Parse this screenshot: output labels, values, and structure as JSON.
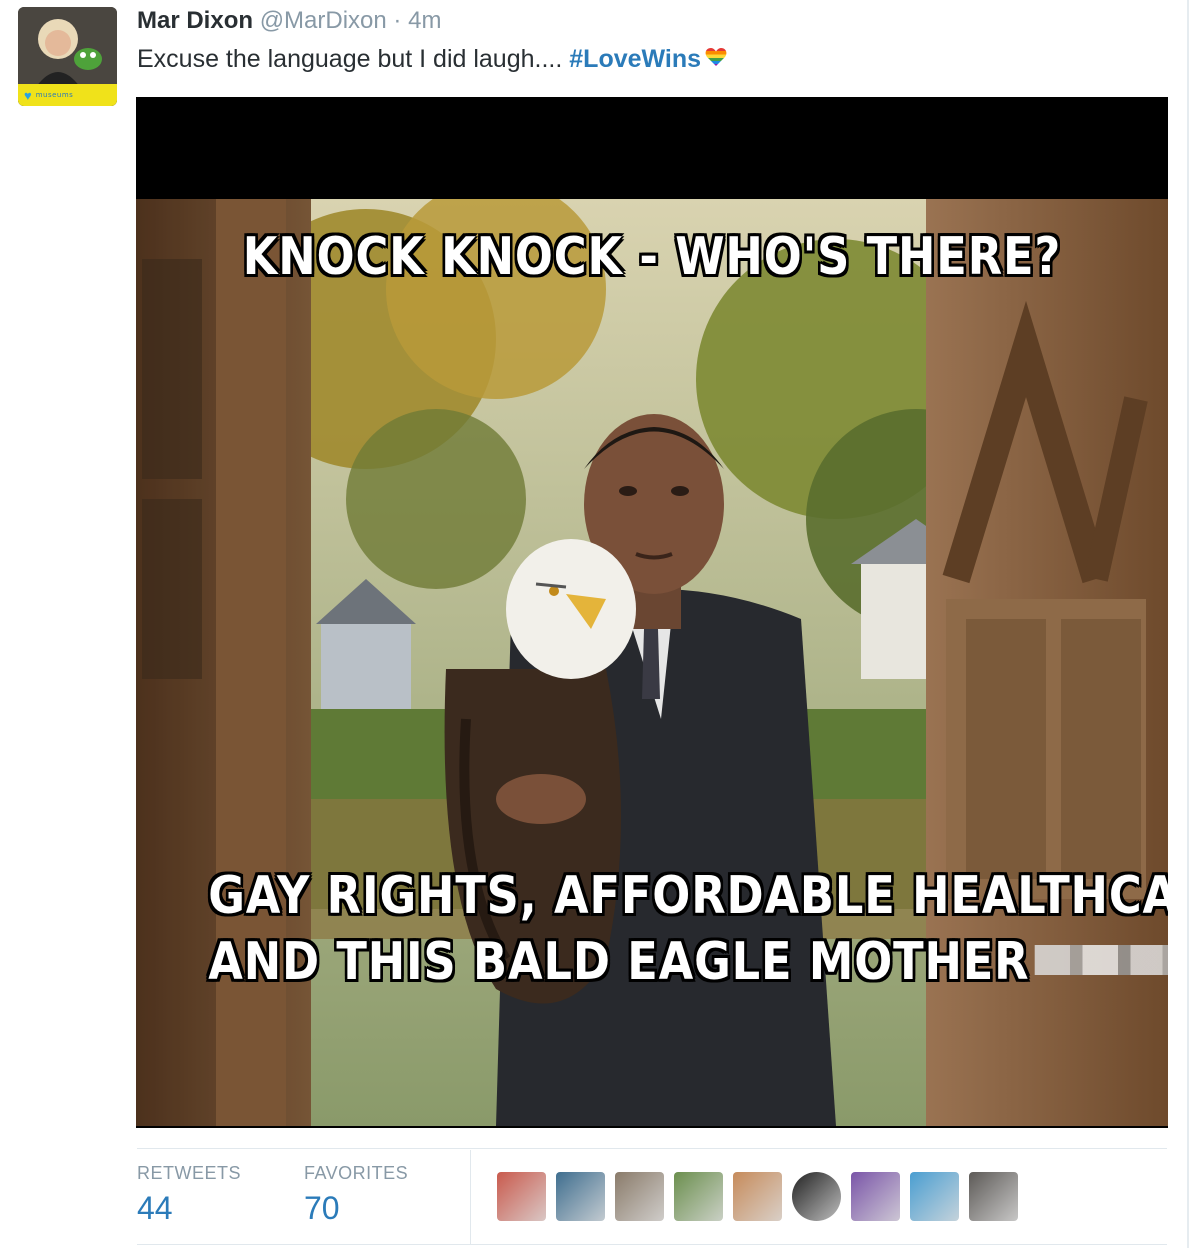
{
  "tweet": {
    "author_name": "Mar Dixon",
    "handle": "@MarDixon",
    "separator": "·",
    "timestamp": "4m",
    "text": "Excuse the language but I did laugh.... ",
    "hashtag": "#LoveWins",
    "avatar_band_text": "museums"
  },
  "media": {
    "top_caption": "KNOCK KNOCK - WHO'S THERE?",
    "bottom_line1": "GAY RIGHTS,  AFFORDABLE HEALTHCARE",
    "bottom_line2": "AND THIS BALD EAGLE MOTHER",
    "bottom_line2_end": "."
  },
  "stats": {
    "retweets_label": "RETWEETS",
    "retweets_count": "44",
    "favorites_label": "FAVORITES",
    "favorites_count": "70"
  },
  "favoriters": [
    {
      "name": "favoriter-1",
      "color": "#c95a4d"
    },
    {
      "name": "favoriter-2",
      "color": "#3f6e8f"
    },
    {
      "name": "favoriter-3",
      "color": "#8a7b6a"
    },
    {
      "name": "favoriter-4",
      "color": "#6b8f4e"
    },
    {
      "name": "favoriter-5",
      "color": "#c68b5b"
    },
    {
      "name": "favoriter-6",
      "color": "#222222"
    },
    {
      "name": "favoriter-7",
      "color": "#7a55a8"
    },
    {
      "name": "favoriter-8",
      "color": "#4a9ed1"
    },
    {
      "name": "favoriter-9",
      "color": "#5d5a57"
    }
  ],
  "colors": {
    "link": "#2b7bb9",
    "muted": "#8899a6",
    "text": "#292f33"
  }
}
